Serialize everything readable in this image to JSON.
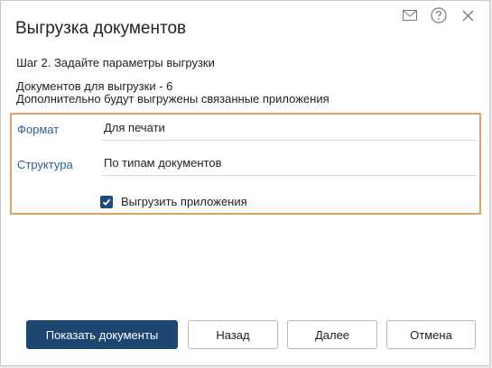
{
  "dialog": {
    "title": "Выгрузка документов",
    "icons": [
      "mail-icon",
      "help-icon",
      "close-icon"
    ]
  },
  "step": {
    "text": "Шаг 2. Задайте параметры выгрузки"
  },
  "info": {
    "documents_count": "Документов для выгрузки - 6",
    "extra_note": "Дополнительно будут выгружены связанные приложения"
  },
  "params": {
    "format_label": "Формат",
    "format_value": "Для печати",
    "structure_label": "Структура",
    "structure_value": "По типам документов",
    "attachments_label": "Выгрузить приложения",
    "attachments_checked": true
  },
  "colors": {
    "accent": "#1d4670",
    "label": "#2d5f93",
    "highlight_border": "#e3a265"
  },
  "buttons": {
    "show_documents": "Показать документы",
    "back": "Назад",
    "next": "Далее",
    "cancel": "Отмена"
  }
}
